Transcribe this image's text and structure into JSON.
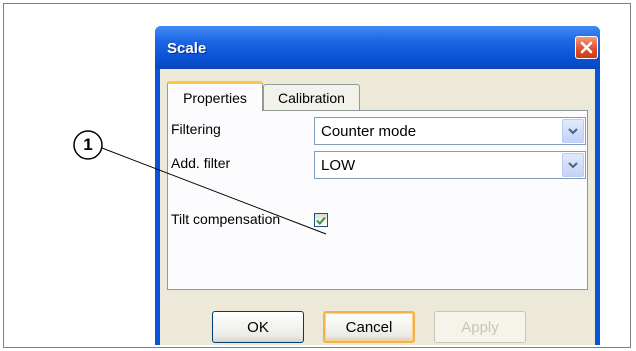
{
  "callout": {
    "number": "1"
  },
  "dialog": {
    "title": "Scale",
    "tabs": [
      {
        "label": "Properties",
        "active": true
      },
      {
        "label": "Calibration",
        "active": false
      }
    ],
    "fields": {
      "filtering": {
        "label": "Filtering",
        "value": "Counter mode"
      },
      "add_filter": {
        "label": "Add. filter",
        "value": "LOW"
      },
      "tilt_compensation": {
        "label": "Tilt compensation",
        "checked": true
      }
    },
    "buttons": {
      "ok": "OK",
      "cancel": "Cancel",
      "apply": "Apply"
    }
  },
  "colors": {
    "title_bar": "#0a53d8",
    "close_button": "#e0502c",
    "dialog_background": "#ece9d8",
    "active_tab_accent": "#ffc83c",
    "checkbox_check": "#2d9a2d"
  },
  "icons": {
    "close": "close-icon",
    "dropdown": "chevron-down-icon",
    "check": "checkmark-icon"
  }
}
